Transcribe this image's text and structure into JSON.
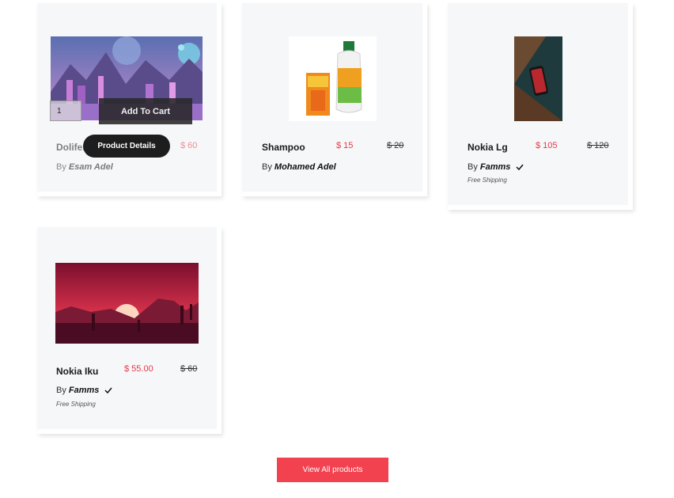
{
  "products": [
    {
      "title": "Dolifer",
      "price": "$ 60",
      "by_label": "By",
      "seller": "Esam Adel",
      "quantity": "1",
      "add_to_cart_label": "Add To Cart",
      "details_label": "Product Details"
    },
    {
      "title": "Shampoo",
      "price": "$ 15",
      "old_price": "$ 20",
      "by_label": "By",
      "seller": "Mohamed Adel"
    },
    {
      "title": "Nokia Lg",
      "price": "$ 105",
      "old_price": "$ 120",
      "by_label": "By",
      "seller": "Famms",
      "shipping": "Free Shipping"
    },
    {
      "title": "Nokia Iku",
      "price": "$ 55.00",
      "old_price": "$ 60",
      "by_label": "By",
      "seller": "Famms",
      "shipping": "Free Shipping"
    }
  ],
  "view_all_label": "View All products",
  "colors": {
    "accent": "#f2414f",
    "price": "#e63946",
    "card_bg": "#f6f7f9"
  }
}
